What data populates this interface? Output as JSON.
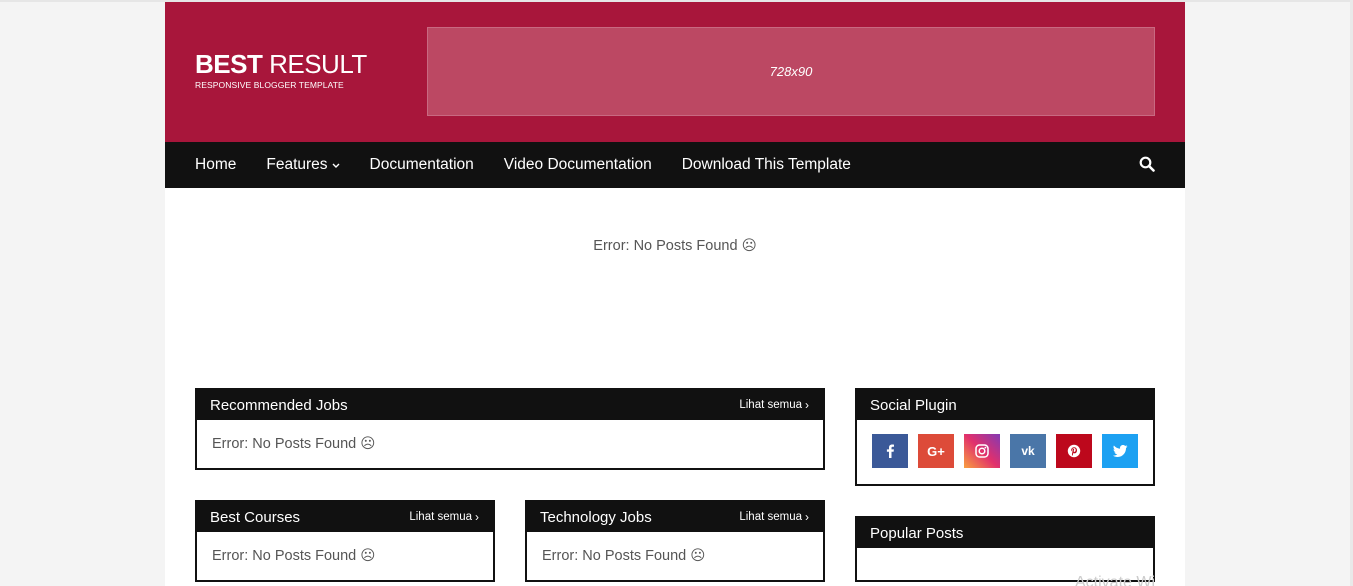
{
  "header": {
    "logo_bold": "BEST",
    "logo_light": "RESULT",
    "tagline": "RESPONSIVE BLOGGER TEMPLATE",
    "ad_label": "728x90"
  },
  "nav": {
    "items": [
      {
        "label": "Home"
      },
      {
        "label": "Features",
        "has_dropdown": true
      },
      {
        "label": "Documentation"
      },
      {
        "label": "Video Documentation"
      },
      {
        "label": "Download This Template"
      }
    ],
    "search_icon": "search-icon"
  },
  "main": {
    "error": "Error: No Posts Found ☹"
  },
  "widgets": {
    "recommended_jobs": {
      "title": "Recommended Jobs",
      "more": "Lihat semua",
      "body": "Error: No Posts Found ☹"
    },
    "best_courses": {
      "title": "Best Courses",
      "more": "Lihat semua",
      "body": "Error: No Posts Found ☹"
    },
    "technology_jobs": {
      "title": "Technology Jobs",
      "more": "Lihat semua",
      "body": "Error: No Posts Found ☹"
    },
    "social_plugin": {
      "title": "Social Plugin",
      "icons": [
        {
          "name": "facebook",
          "glyph": "f",
          "color": "#3b5998"
        },
        {
          "name": "google-plus",
          "glyph": "G+",
          "color": "#dd4b39"
        },
        {
          "name": "instagram",
          "glyph": "",
          "color": "#c13584"
        },
        {
          "name": "vk",
          "glyph": "vk",
          "color": "#4a76a8"
        },
        {
          "name": "pinterest",
          "glyph": "P",
          "color": "#bd081c"
        },
        {
          "name": "twitter",
          "glyph": "t",
          "color": "#1da1f2"
        }
      ]
    },
    "popular_posts": {
      "title": "Popular Posts"
    }
  },
  "watermark": "Activate Wi",
  "colors": {
    "header_bg": "#a8163b",
    "nav_bg": "#111111",
    "ad_bg": "#bc4863"
  }
}
